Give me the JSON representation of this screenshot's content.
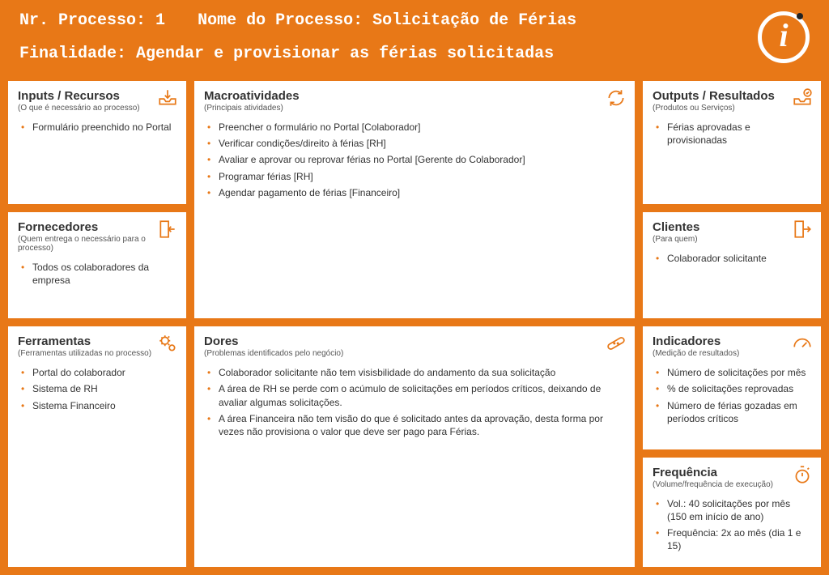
{
  "header": {
    "nr_label": "Nr. Processo:",
    "nr_value": "1",
    "nome_label": "Nome do Processo:",
    "nome_value": "Solicitação de Férias",
    "finalidade_label": "Finalidade:",
    "finalidade_value": "Agendar e provisionar as férias solicitadas"
  },
  "cards": {
    "inputs": {
      "title": "Inputs / Recursos",
      "sub": "(O que é necessário ao processo)",
      "items": [
        "Formulário preenchido no Portal"
      ]
    },
    "macro": {
      "title": "Macroatividades",
      "sub": "(Principais atividades)",
      "items": [
        "Preencher o formulário no Portal [Colaborador]",
        "Verificar condições/direito à férias [RH]",
        "Avaliar e aprovar ou reprovar férias no Portal [Gerente do Colaborador]",
        "Programar férias [RH]",
        "Agendar pagamento de férias [Financeiro]"
      ]
    },
    "outputs": {
      "title": "Outputs / Resultados",
      "sub": "(Produtos ou Serviços)",
      "items": [
        "Férias aprovadas e provisionadas"
      ]
    },
    "fornec": {
      "title": "Fornecedores",
      "sub": "(Quem entrega o necessário para o processo)",
      "items": [
        "Todos os colaboradores da empresa"
      ]
    },
    "clientes": {
      "title": "Clientes",
      "sub": "(Para quem)",
      "items": [
        "Colaborador solicitante"
      ]
    },
    "ferram": {
      "title": "Ferramentas",
      "sub": "(Ferramentas utilizadas no processo)",
      "items": [
        "Portal do colaborador",
        "Sistema de RH",
        "Sistema Financeiro"
      ]
    },
    "dores": {
      "title": "Dores",
      "sub": "(Problemas identificados pelo negócio)",
      "items": [
        "Colaborador solicitante não tem visisbilidade do andamento da sua solicitação",
        "A área de RH se perde com o acúmulo de solicitações em períodos críticos, deixando de avaliar algumas solicitações.",
        "A área Financeira não tem visão do que é solicitado antes da aprovação, desta forma por vezes não provisiona o valor que deve ser pago para Férias."
      ]
    },
    "indic": {
      "title": "Indicadores",
      "sub": "(Medição de resultados)",
      "items": [
        "Número de solicitações por mês",
        "% de solicitações reprovadas",
        "Número de férias gozadas em períodos críticos"
      ]
    },
    "freq": {
      "title": "Frequência",
      "sub": "(Volume/frequência de execução)",
      "items": [
        "Vol.: 40 solicitações por mês (150 em início de ano)",
        "Frequência: 2x ao mês (dia 1 e 15)"
      ]
    }
  }
}
